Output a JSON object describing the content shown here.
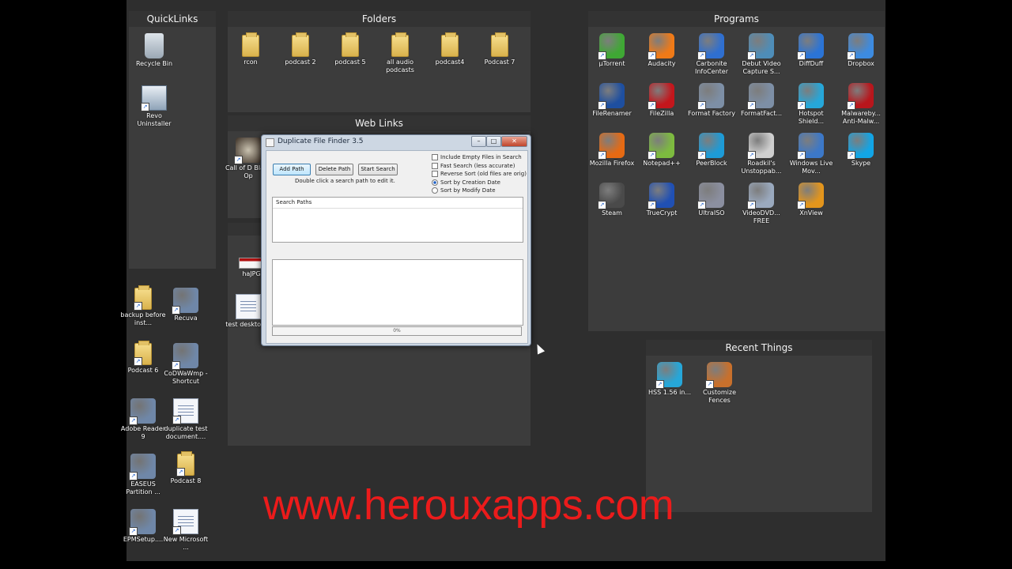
{
  "fences": {
    "quicklinks": {
      "title": "QuickLinks",
      "items": [
        {
          "label": "Recycle Bin",
          "icon": "recycle-bin-icon"
        },
        {
          "label": "Revo Uninstaller",
          "icon": "revo-uninstaller-icon"
        }
      ]
    },
    "folders": {
      "title": "Folders",
      "items": [
        {
          "label": "rcon",
          "icon": "folder-icon"
        },
        {
          "label": "podcast 2",
          "icon": "folder-icon"
        },
        {
          "label": "podcast 5",
          "icon": "folder-icon"
        },
        {
          "label": "all audio podcasts",
          "icon": "folder-icon"
        },
        {
          "label": "podcast4",
          "icon": "folder-icon"
        },
        {
          "label": "Podcast 7",
          "icon": "folder-icon"
        }
      ]
    },
    "weblinks": {
      "title": "Web Links",
      "items": [
        {
          "label": "Call of D Black Op",
          "icon": "call-of-duty-icon"
        }
      ]
    },
    "misc": {
      "items": [
        {
          "label": "haJPG",
          "icon": "image-icon"
        },
        {
          "label": "test desktop.d",
          "icon": "document-icon"
        }
      ]
    },
    "programs": {
      "title": "Programs",
      "items": [
        {
          "label": "µTorrent",
          "icon": "utorrent-icon",
          "color": "#3fa834"
        },
        {
          "label": "Audacity",
          "icon": "audacity-icon",
          "color": "#f07a17"
        },
        {
          "label": "Carbonite InfoCenter",
          "icon": "carbonite-icon",
          "color": "#2f6fd0"
        },
        {
          "label": "Debut Video Capture S...",
          "icon": "debut-icon",
          "color": "#4e8db8"
        },
        {
          "label": "DiffDuff",
          "icon": "diffduff-icon",
          "color": "#2b74d6"
        },
        {
          "label": "Dropbox",
          "icon": "dropbox-icon",
          "color": "#3d8be0"
        },
        {
          "label": "FileRenamer",
          "icon": "filerenamer-icon",
          "color": "#1e4fa0"
        },
        {
          "label": "FileZilla",
          "icon": "filezilla-icon",
          "color": "#c4161c"
        },
        {
          "label": "Format Factory",
          "icon": "format-factory-icon",
          "color": "#7d8fa6"
        },
        {
          "label": "FormatFact...",
          "icon": "format-factory-icon",
          "color": "#7d8fa6"
        },
        {
          "label": "Hotspot Shield...",
          "icon": "hotspot-shield-icon",
          "color": "#26a7d9"
        },
        {
          "label": "Malwareby... Anti-Malw...",
          "icon": "malwarebytes-icon",
          "color": "#b8161c"
        },
        {
          "label": "Mozilla Firefox",
          "icon": "firefox-icon",
          "color": "#e66a13"
        },
        {
          "label": "Notepad++",
          "icon": "notepad-plus-icon",
          "color": "#7dbb3f"
        },
        {
          "label": "PeerBlock",
          "icon": "peerblock-icon",
          "color": "#1d9bd7"
        },
        {
          "label": "Roadkil's Unstoppab...",
          "icon": "roadkil-icon",
          "color": "#cfcfcf"
        },
        {
          "label": "Windows Live Mov...",
          "icon": "movie-maker-icon",
          "color": "#3c78c8"
        },
        {
          "label": "Skype",
          "icon": "skype-icon",
          "color": "#12a5e6"
        },
        {
          "label": "Steam",
          "icon": "steam-icon",
          "color": "#4a4a4a"
        },
        {
          "label": "TrueCrypt",
          "icon": "truecrypt-icon",
          "color": "#2050b4"
        },
        {
          "label": "UltraISO",
          "icon": "ultraiso-icon",
          "color": "#8b8fa0"
        },
        {
          "label": "VideoDVD... FREE",
          "icon": "video-dvd-icon",
          "color": "#9aa9be"
        },
        {
          "label": "XnView",
          "icon": "xnview-icon",
          "color": "#e3951c"
        }
      ]
    },
    "recent": {
      "title": "Recent Things",
      "items": [
        {
          "label": "HSS 1.56 in...",
          "icon": "hotspot-shield-icon",
          "color": "#26a7d9"
        },
        {
          "label": "Customize Fences",
          "icon": "fences-icon",
          "color": "#c8702c"
        }
      ]
    }
  },
  "desktop_icons": [
    {
      "label": "backup before inst...",
      "icon": "folder-icon"
    },
    {
      "label": "Recuva",
      "icon": "recuva-icon"
    },
    {
      "label": "Podcast 6",
      "icon": "folder-icon"
    },
    {
      "label": "CoDWaWmp - Shortcut",
      "icon": "codwaw-icon"
    },
    {
      "label": "Adobe Reader 9",
      "icon": "adobe-reader-icon"
    },
    {
      "label": "duplicate test document....",
      "icon": "document-icon"
    },
    {
      "label": "EASEUS Partition ...",
      "icon": "easeus-icon"
    },
    {
      "label": "Podcast 8",
      "icon": "folder-icon"
    },
    {
      "label": "EPMSetup....",
      "icon": "installer-icon"
    },
    {
      "label": "New Microsoft ...",
      "icon": "document-icon"
    }
  ],
  "dialog": {
    "title": "Duplicate File Finder 3.5",
    "add_path": "Add Path",
    "delete_path": "Delete Path",
    "start_search": "Start Search",
    "hint": "Double click a search path to edit it.",
    "options": [
      {
        "label": "Include Empty Files in Search",
        "type": "checkbox",
        "checked": false
      },
      {
        "label": "Fast Search (less accurate)",
        "type": "checkbox",
        "checked": false
      },
      {
        "label": "Reverse Sort (old files are orig)",
        "type": "checkbox",
        "checked": false
      },
      {
        "label": "Sort by Creation Date",
        "type": "radio",
        "checked": true
      },
      {
        "label": "Sort by Modify Date",
        "type": "radio",
        "checked": false
      }
    ],
    "search_paths_header": "Search Paths",
    "progress": "0%",
    "progress_value": 0
  },
  "watermark": "www.herouxapps.com"
}
